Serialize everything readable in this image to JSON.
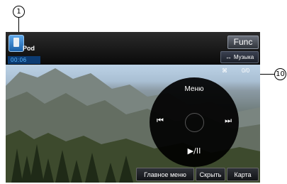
{
  "callouts": {
    "left": "1",
    "right": "10"
  },
  "source": {
    "label": "Pod",
    "time": "00:06"
  },
  "buttons": {
    "func": "Func",
    "music_arrow": "↔",
    "music": "Музыка"
  },
  "indicator": {
    "icon": "⌘",
    "count": "0/0"
  },
  "pad": {
    "menu": "Меню",
    "prev": "⏮",
    "next": "⏭",
    "play": "▶/II"
  },
  "bottom": {
    "main_menu": "Главное меню",
    "hide": "Скрыть",
    "map": "Карта"
  }
}
